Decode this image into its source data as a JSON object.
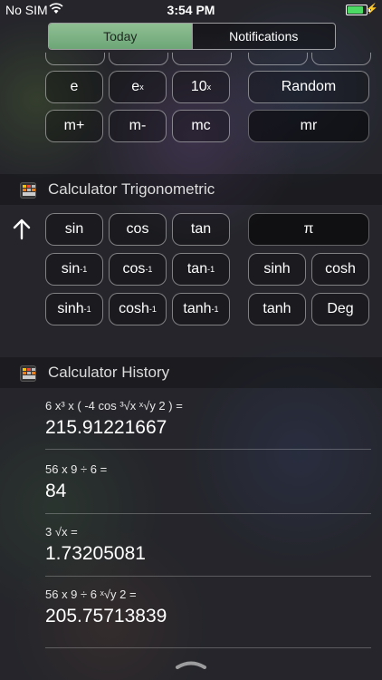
{
  "status_bar": {
    "carrier": "No SIM",
    "time": "3:54 PM",
    "battery_level": 0.95
  },
  "tabs": {
    "today": "Today",
    "notifications": "Notifications",
    "selected": "Today"
  },
  "calculator_top": {
    "row1": {
      "e": "e",
      "ex": "e",
      "ex_sup": "x",
      "tenx": "10",
      "tenx_sup": "x",
      "random": "Random"
    },
    "row2": {
      "mplus": "m+",
      "mminus": "m-",
      "mc": "mc",
      "mr": "mr"
    }
  },
  "trig": {
    "title": "Calculator Trigonometric",
    "row1": {
      "sin": "sin",
      "cos": "cos",
      "tan": "tan",
      "pi": "π"
    },
    "row2": {
      "asin": "sin",
      "acos": "cos",
      "atan": "tan",
      "inv": "-1",
      "sinh": "sinh",
      "cosh": "cosh"
    },
    "row3": {
      "asinh": "sinh",
      "acosh": "cosh",
      "atanh": "tanh",
      "tanh": "tanh",
      "deg": "Deg"
    }
  },
  "history": {
    "title": "Calculator History",
    "items": [
      {
        "expression": "6 x³ x ( -4 cos ³√x ˣ√y 2 ) =",
        "result": "215.91221667"
      },
      {
        "expression": "56 x 9 ÷ 6 =",
        "result": "84"
      },
      {
        "expression": "3 √x =",
        "result": "1.73205081"
      },
      {
        "expression": "56 x 9 ÷ 6 ˣ√y 2 =",
        "result": "205.75713839"
      }
    ]
  },
  "colors": {
    "accent_green": "#7fb486",
    "battery_green": "#4cd964"
  }
}
